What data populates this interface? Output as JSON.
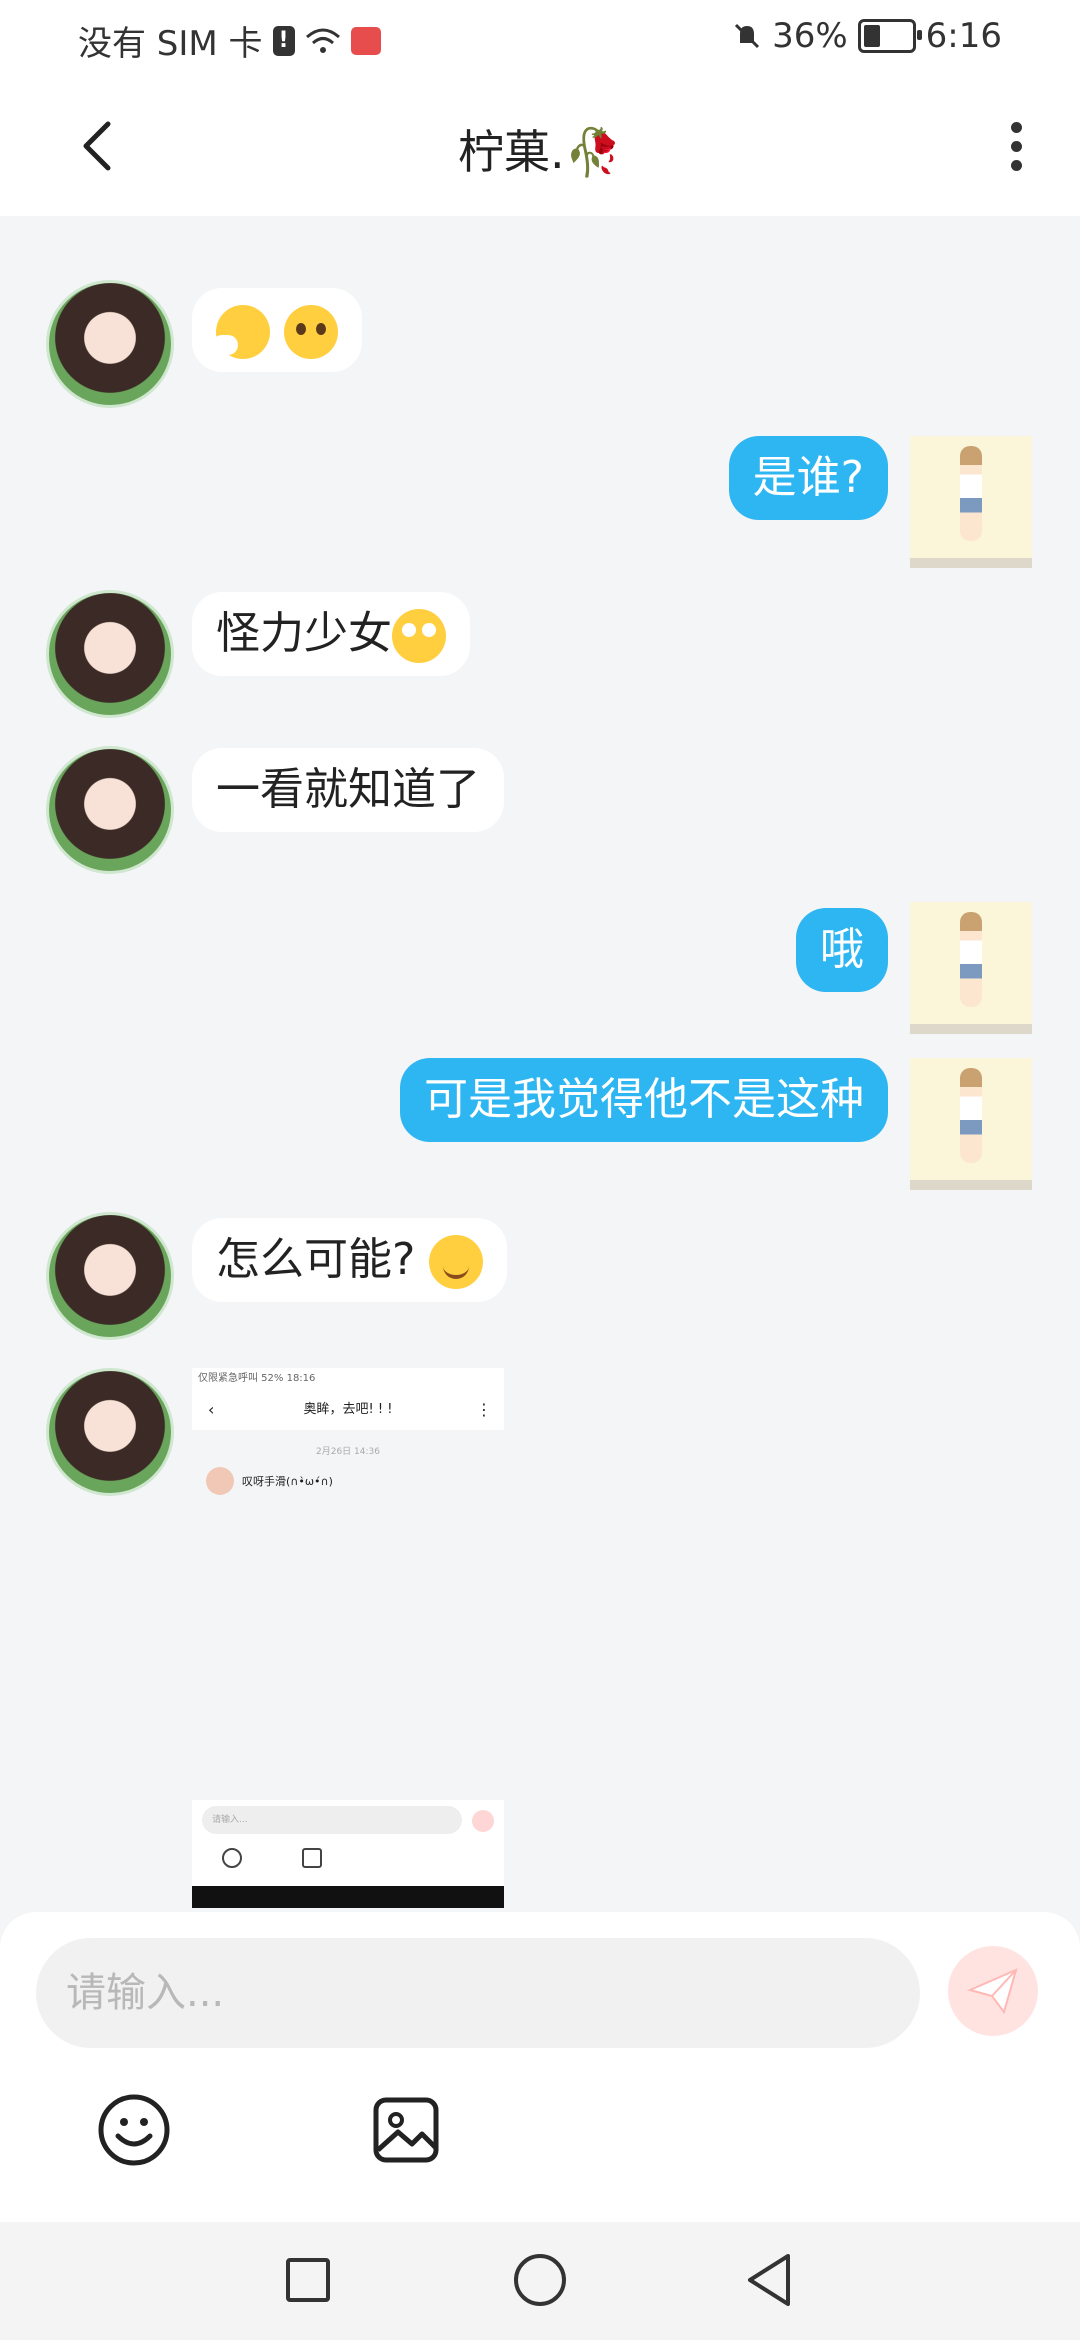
{
  "status_bar": {
    "carrier": "没有 SIM 卡",
    "battery": "36%",
    "time": "6:16"
  },
  "header": {
    "title": "柠菓.🥀"
  },
  "messages": [
    {
      "side": "in",
      "text": "😤🥺"
    },
    {
      "side": "out",
      "text": "是谁?"
    },
    {
      "side": "in",
      "text": "怪力少女🙄"
    },
    {
      "side": "in",
      "text": "一看就知道了"
    },
    {
      "side": "out",
      "text": "哦"
    },
    {
      "side": "out",
      "text": "可是我觉得他不是这种"
    },
    {
      "side": "in",
      "text": "怎么可能? 😊"
    }
  ],
  "screenshot_message": {
    "status": "仅限紧急呼叫   52% 18:16",
    "title": "奥眸，去吧! ! !",
    "date": "2月26日 14:36",
    "preview": "叹呀手滑(∩•̀ω•́∩)",
    "input_placeholder": "请输入..."
  },
  "composer": {
    "placeholder": "请输入..."
  },
  "icons": [
    "back-icon",
    "more-icon",
    "send-icon",
    "emoji-icon",
    "image-icon",
    "nav-square-icon",
    "nav-circle-icon",
    "nav-back-icon"
  ]
}
